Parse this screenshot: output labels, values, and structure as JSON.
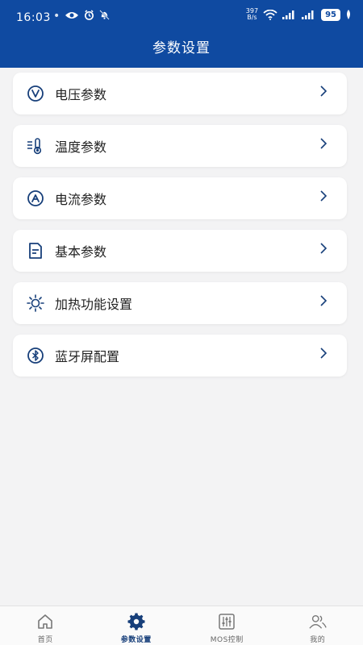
{
  "status_bar": {
    "time": "16:03",
    "dot": "•",
    "net_speed_value": "397",
    "net_speed_unit": "B/s",
    "battery": "95"
  },
  "header": {
    "title": "参数设置"
  },
  "menu": {
    "items": [
      {
        "label": "电压参数",
        "icon": "voltage-icon"
      },
      {
        "label": "温度参数",
        "icon": "thermometer-icon"
      },
      {
        "label": "电流参数",
        "icon": "current-icon"
      },
      {
        "label": "基本参数",
        "icon": "document-icon"
      },
      {
        "label": "加热功能设置",
        "icon": "sun-icon"
      },
      {
        "label": "蓝牙屏配置",
        "icon": "bluetooth-icon"
      }
    ]
  },
  "tabbar": {
    "tabs": [
      {
        "label": "首页",
        "icon": "home-icon"
      },
      {
        "label": "参数设置",
        "icon": "gear-icon",
        "active": true
      },
      {
        "label": "MOS控制",
        "icon": "sliders-icon"
      },
      {
        "label": "我的",
        "icon": "user-icon"
      }
    ]
  },
  "colors": {
    "primary": "#0f4aa1",
    "background": "#f3f3f4",
    "active_tab": "#173f7a"
  }
}
